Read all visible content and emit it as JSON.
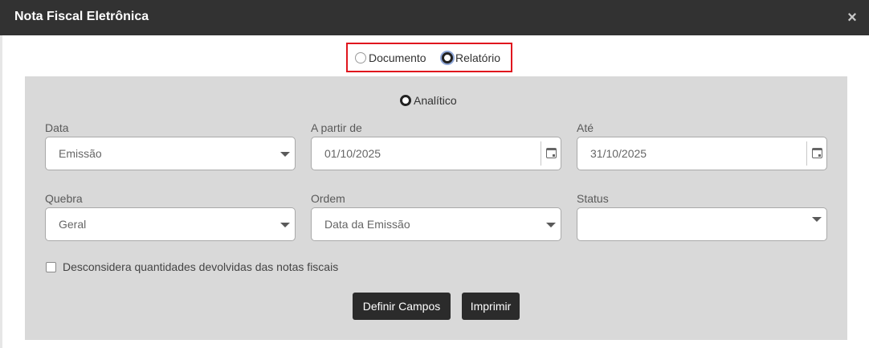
{
  "dialog": {
    "title": "Nota Fiscal Eletrônica",
    "close_icon": "close-icon"
  },
  "mode": {
    "options": [
      {
        "label": "Documento",
        "selected": false
      },
      {
        "label": "Relatório",
        "selected": true
      }
    ],
    "highlight_color": "#e0161e"
  },
  "report": {
    "type_label": "Analítico",
    "fields": {
      "data": {
        "label": "Data",
        "value": "Emissão"
      },
      "a_partir_de": {
        "label": "A partir de",
        "value": "01/10/2025"
      },
      "ate": {
        "label": "Até",
        "value": "31/10/2025"
      },
      "quebra": {
        "label": "Quebra",
        "value": "Geral"
      },
      "ordem": {
        "label": "Ordem",
        "value": "Data da Emissão"
      },
      "status": {
        "label": "Status",
        "value": ""
      }
    },
    "checkbox": {
      "label": "Desconsidera quantidades devolvidas das notas fiscais",
      "checked": false
    },
    "buttons": {
      "definir_campos": "Definir Campos",
      "imprimir": "Imprimir"
    }
  },
  "colors": {
    "titlebar": "#323232",
    "panel": "#d9d9d9",
    "button": "#2b2b2b"
  }
}
